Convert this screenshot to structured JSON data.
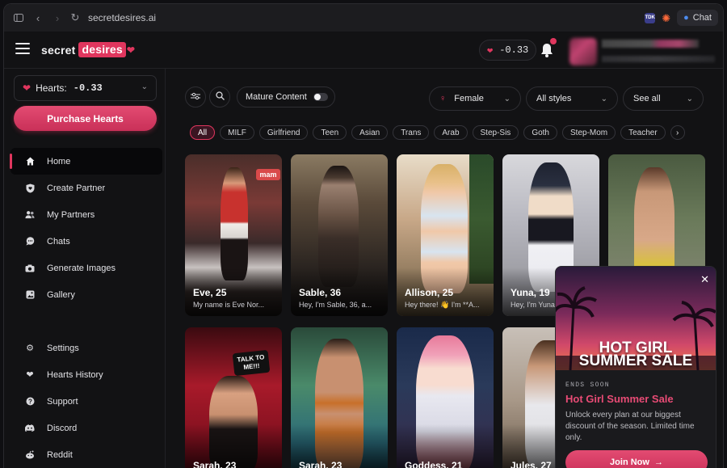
{
  "browser": {
    "url": "secretdesires.ai",
    "chat_label": "Chat",
    "ext_label": "TDK"
  },
  "header": {
    "logo_part1": "secret",
    "logo_part2": "desires",
    "hearts_balance": "-0.33"
  },
  "sidebar": {
    "hearts_label": "Hearts:",
    "hearts_value": "-0.33",
    "purchase_label": "Purchase Hearts",
    "items": [
      {
        "label": "Home",
        "icon": "home-icon"
      },
      {
        "label": "Create Partner",
        "icon": "heart-shield-icon"
      },
      {
        "label": "My Partners",
        "icon": "users-icon"
      },
      {
        "label": "Chats",
        "icon": "chat-bubble-icon"
      },
      {
        "label": "Generate Images",
        "icon": "camera-icon"
      },
      {
        "label": "Gallery",
        "icon": "gallery-icon"
      },
      {
        "label": "Settings",
        "icon": "gear-icon"
      },
      {
        "label": "Hearts History",
        "icon": "heart-icon"
      },
      {
        "label": "Support",
        "icon": "help-icon"
      },
      {
        "label": "Discord",
        "icon": "discord-icon"
      },
      {
        "label": "Reddit",
        "icon": "reddit-icon"
      }
    ]
  },
  "filters": {
    "mature_label": "Mature Content",
    "gender": "Female",
    "style": "All styles",
    "see_all": "See all"
  },
  "chips": [
    "All",
    "MILF",
    "Girlfriend",
    "Teen",
    "Asian",
    "Trans",
    "Arab",
    "Step-Sis",
    "Goth",
    "Step-Mom",
    "Teacher"
  ],
  "cards_row1": [
    {
      "name": "Eve, 25",
      "desc": "My name is Eve Nor..."
    },
    {
      "name": "Sable, 36",
      "desc": "Hey, I'm Sable, 36, a..."
    },
    {
      "name": "Allison, 25",
      "desc": "Hey there! 👋 I'm **A..."
    },
    {
      "name": "Yuna, 19",
      "desc": "Hey, I'm Yuna"
    },
    {
      "name": "",
      "desc": ""
    }
  ],
  "cards_row2": [
    {
      "name": "Sarah, 23",
      "desc": ""
    },
    {
      "name": "Sarah, 23",
      "desc": ""
    },
    {
      "name": "Goddess, 21",
      "desc": ""
    },
    {
      "name": "Jules, 27",
      "desc": ""
    }
  ],
  "card_sign_text": "TALK TO ME!!!",
  "card_sign_text2": "mam",
  "promo": {
    "headline1": "HOT GIRL",
    "headline2": "SUMMER SALE",
    "ends": "ENDS SOON",
    "title": "Hot Girl Summer Sale",
    "desc": "Unlock every plan at our biggest discount of the season. Limited time only.",
    "cta": "Join Now"
  },
  "colors": {
    "accent": "#e0365e",
    "background": "#121214"
  }
}
